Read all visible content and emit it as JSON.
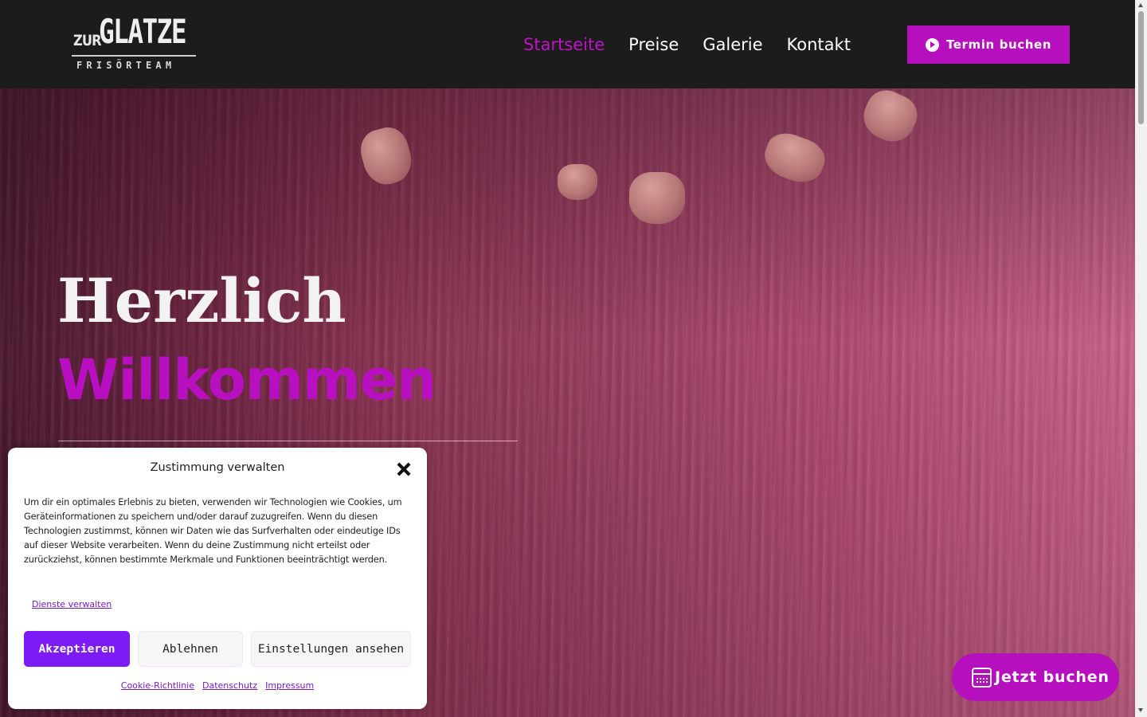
{
  "header": {
    "logo": {
      "top_text": "ZUR",
      "main_text": "GLATZE",
      "sub_text": "FRISÖRTEAM"
    },
    "nav": [
      {
        "label": "Startseite",
        "active": true
      },
      {
        "label": "Preise",
        "active": false
      },
      {
        "label": "Galerie",
        "active": false
      },
      {
        "label": "Kontakt",
        "active": false
      }
    ],
    "cta_label": "Termin buchen",
    "cta_icon": "play-circle-icon"
  },
  "hero": {
    "title_line1": "Herzlich",
    "title_line2": "Willkommen"
  },
  "consent": {
    "title": "Zustimmung verwalten",
    "body": "Um dir ein optimales Erlebnis zu bieten, verwenden wir Technologien wie Cookies, um Geräteinformationen zu speichern und/oder darauf zuzugreifen. Wenn du diesen Technologien zustimmst, können wir Daten wie das Surfverhalten oder eindeutige IDs auf dieser Website verarbeiten. Wenn du deine Zustimmung nicht erteilst oder zurückziehst, können bestimmte Merkmale und Funktionen beeinträchtigt werden.",
    "manage_link": "Dienste verwalten",
    "accept_label": "Akzeptieren",
    "deny_label": "Ablehnen",
    "prefs_label": "Einstellungen ansehen",
    "links": [
      "Cookie-Richtlinie",
      "Datenschutz",
      "Impressum"
    ]
  },
  "floating_button": {
    "label": "Jetzt buchen",
    "icon": "calendar-icon"
  },
  "colors": {
    "accent": "#b60fbd",
    "header_bg": "#1c1c1c",
    "consent_accept": "#7c1bf5",
    "consent_link": "#7a1cc4"
  }
}
